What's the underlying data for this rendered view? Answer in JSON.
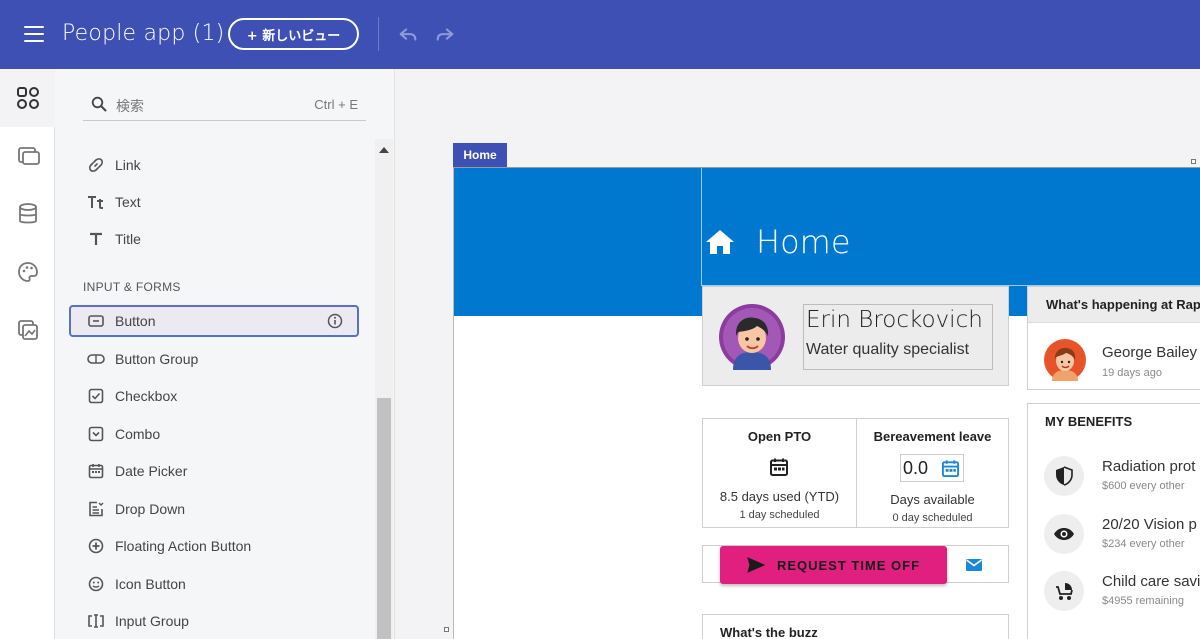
{
  "topbar": {
    "app_title": "People app (1)",
    "new_view_label": "+ 新しいビュー"
  },
  "search": {
    "placeholder": "検索",
    "shortcut": "Ctrl + E"
  },
  "toolbox": {
    "basic_items": [
      {
        "label": "Link",
        "icon": "link-icon"
      },
      {
        "label": "Text",
        "icon": "text-icon"
      },
      {
        "label": "Title",
        "icon": "title-icon"
      }
    ],
    "section_input": "INPUT & FORMS",
    "input_items": [
      {
        "label": "Button",
        "icon": "button-icon",
        "selected": true
      },
      {
        "label": "Button Group",
        "icon": "button-group-icon"
      },
      {
        "label": "Checkbox",
        "icon": "checkbox-icon"
      },
      {
        "label": "Combo",
        "icon": "combo-icon"
      },
      {
        "label": "Date Picker",
        "icon": "date-picker-icon"
      },
      {
        "label": "Drop Down",
        "icon": "drop-down-icon"
      },
      {
        "label": "Floating Action Button",
        "icon": "fab-icon"
      },
      {
        "label": "Icon Button",
        "icon": "icon-button-icon"
      },
      {
        "label": "Input Group",
        "icon": "input-group-icon"
      }
    ]
  },
  "canvas": {
    "view_tag": "Home",
    "page_title": "Home",
    "profile": {
      "name": "Erin Brockovich",
      "role": "Water quality specialist"
    },
    "pto": {
      "title": "Open PTO",
      "used": "8.5 days used (YTD)",
      "scheduled": "1 day scheduled"
    },
    "bereavement": {
      "title": "Bereavement leave",
      "value": "0.0",
      "available": "Days available",
      "scheduled": "0 day scheduled"
    },
    "request_button": "REQUEST TIME OFF",
    "buzz_title": "What's the buzz",
    "happening": {
      "title": "What's happening at Rap",
      "person": "George Bailey",
      "time": "19 days ago"
    },
    "benefits": {
      "title": "MY BENEFITS",
      "items": [
        {
          "name": "Radiation prot",
          "sub": "$600 every other",
          "icon": "shield-icon"
        },
        {
          "name": "20/20 Vision p",
          "sub": "$234 every other",
          "icon": "eye-icon"
        },
        {
          "name": "Child care savi",
          "sub": "$4955 remaining",
          "icon": "stroller-icon"
        }
      ]
    }
  },
  "colors": {
    "topbar": "#3e50b4",
    "banner": "#0078d0",
    "accent_button": "#e01f7e"
  }
}
